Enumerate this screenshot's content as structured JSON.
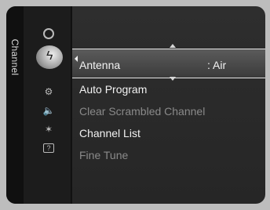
{
  "side_label": "Channel",
  "menu": {
    "items": [
      {
        "label": "Antenna",
        "value": ": Air"
      },
      {
        "label": "Auto Program"
      },
      {
        "label": "Clear Scrambled Channel"
      },
      {
        "label": "Channel List"
      },
      {
        "label": "Fine Tune"
      }
    ]
  },
  "icons": [
    "clock-icon",
    "satellite-dish-icon",
    "gear-icon",
    "speaker-icon",
    "sparkle-icon",
    "help-box-icon"
  ],
  "colors": {
    "background": "#262626",
    "highlight": "#4b4b4b",
    "text": "#f2f2f2",
    "disabled": "#8a8a8a"
  }
}
